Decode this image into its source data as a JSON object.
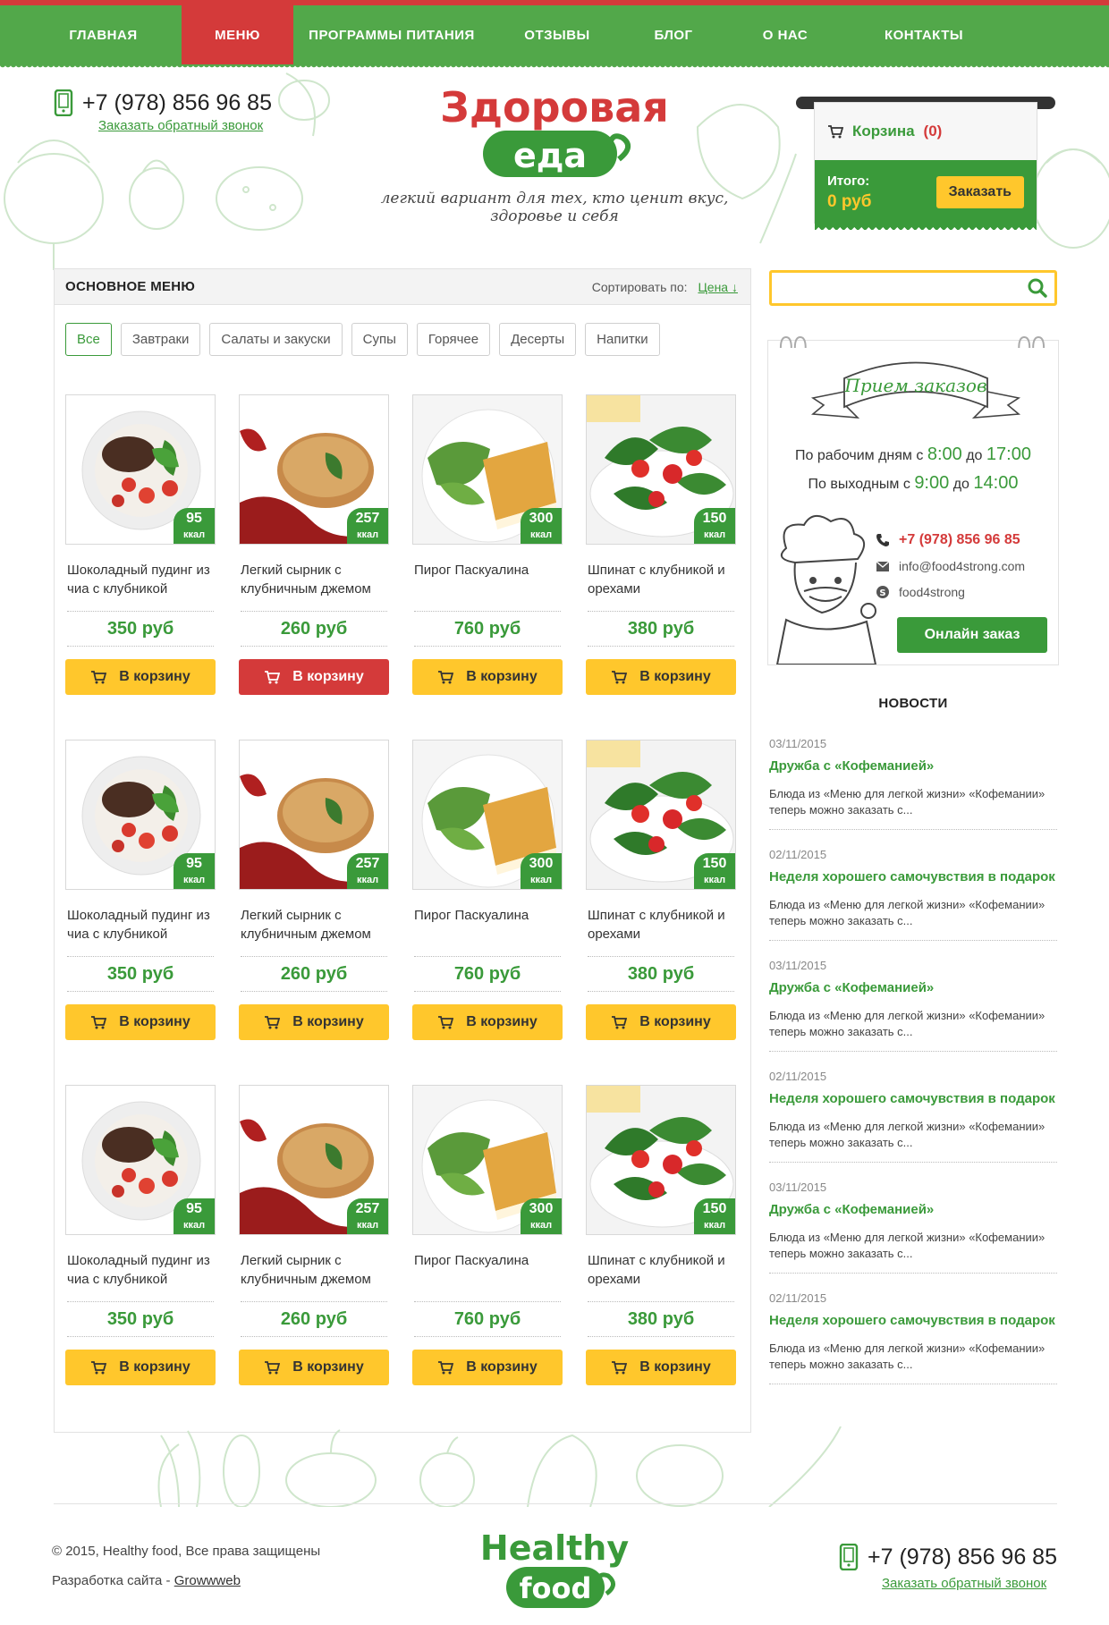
{
  "nav": {
    "items": [
      {
        "label": "ГЛАВНАЯ",
        "active": false
      },
      {
        "label": "МЕНЮ",
        "active": true
      },
      {
        "label": "ПРОГРАММЫ ПИТАНИЯ",
        "active": false
      },
      {
        "label": "ОТЗЫВЫ",
        "active": false
      },
      {
        "label": "БЛОГ",
        "active": false
      },
      {
        "label": "О НАС",
        "active": false
      },
      {
        "label": "КОНТАКТЫ",
        "active": false
      }
    ]
  },
  "header": {
    "phone": "+7 (978) 856 96 85",
    "callback": "Заказать обратный звонок",
    "logo_line1": "Здоровая",
    "logo_line2": "еда",
    "tagline": "легкий вариант для тех, кто ценит вкус, здоровье и себя"
  },
  "cart": {
    "label": "Корзина",
    "count": "(0)",
    "total_label": "Итого:",
    "total_value": "0 руб",
    "order_button": "Заказать"
  },
  "menu": {
    "title": "ОСНОВНОЕ МЕНЮ",
    "sort_label": "Сортировать по:",
    "sort_value": "Цена ↓",
    "filters": [
      "Все",
      "Завтраки",
      "Салаты и закуски",
      "Супы",
      "Горячее",
      "Десерты",
      "Напитки"
    ],
    "active_filter": 0,
    "buy_label": "В корзину",
    "kcal_unit": "ккал",
    "products": [
      {
        "name": "Шоколадный пудинг из чиа с клубникой",
        "price": "350 руб",
        "kcal": "95",
        "img": "pudding"
      },
      {
        "name": "Легкий сырник с клубничным джемом",
        "price": "260 руб",
        "kcal": "257",
        "img": "syrnik"
      },
      {
        "name": "Пирог Паскуалина",
        "price": "760 руб",
        "kcal": "300",
        "img": "pie"
      },
      {
        "name": "Шпинат с клубникой и орехами",
        "price": "380 руб",
        "kcal": "150",
        "img": "spinach"
      }
    ],
    "hover_index": 1,
    "rows": 3
  },
  "search": {
    "placeholder": ""
  },
  "hours": {
    "banner": "Прием заказов",
    "weekday_label": "По рабочим дням с",
    "weekday_from": "8:00",
    "weekday_to_label": "до",
    "weekday_to": "17:00",
    "weekend_label": "По выходным с",
    "weekend_from": "9:00",
    "weekend_to_label": "до",
    "weekend_to": "14:00",
    "phone": "+7 (978) 856 96 85",
    "email": "info@food4strong.com",
    "skype": "food4strong",
    "online_button": "Онлайн заказ"
  },
  "news": {
    "title": "НОВОСТИ",
    "items": [
      {
        "date": "03/11/2015",
        "title": "Дружба с «Кофеманией»",
        "text": "Блюда из «Меню для легкой жизни» «Кофемании» теперь можно заказать с..."
      },
      {
        "date": "02/11/2015",
        "title": "Неделя хорошего самочувствия в подарок",
        "text": "Блюда из «Меню для легкой жизни» «Кофемании» теперь можно заказать с..."
      },
      {
        "date": "03/11/2015",
        "title": "Дружба с «Кофеманией»",
        "text": "Блюда из «Меню для легкой жизни» «Кофемании» теперь можно заказать с..."
      },
      {
        "date": "02/11/2015",
        "title": "Неделя хорошего самочувствия в подарок",
        "text": "Блюда из «Меню для легкой жизни» «Кофемании» теперь можно заказать с..."
      },
      {
        "date": "03/11/2015",
        "title": "Дружба с «Кофеманией»",
        "text": "Блюда из «Меню для легкой жизни» «Кофемании» теперь можно заказать с..."
      },
      {
        "date": "02/11/2015",
        "title": "Неделя хорошего самочувствия в подарок",
        "text": "Блюда из «Меню для легкой жизни» «Кофемании» теперь можно заказать с..."
      }
    ]
  },
  "footer": {
    "copyright": "© 2015, Healthy food, Все права защищены",
    "dev_label": "Разработка сайта -",
    "dev_link": "Growwweb",
    "logo_line1": "Healthy",
    "logo_line2": "food",
    "phone": "+7 (978) 856 96 85",
    "callback": "Заказать обратный звонок"
  },
  "colors": {
    "green": "#52a84a",
    "dark_green": "#3a9a3a",
    "red": "#d43a3a",
    "yellow": "#ffc72c"
  }
}
